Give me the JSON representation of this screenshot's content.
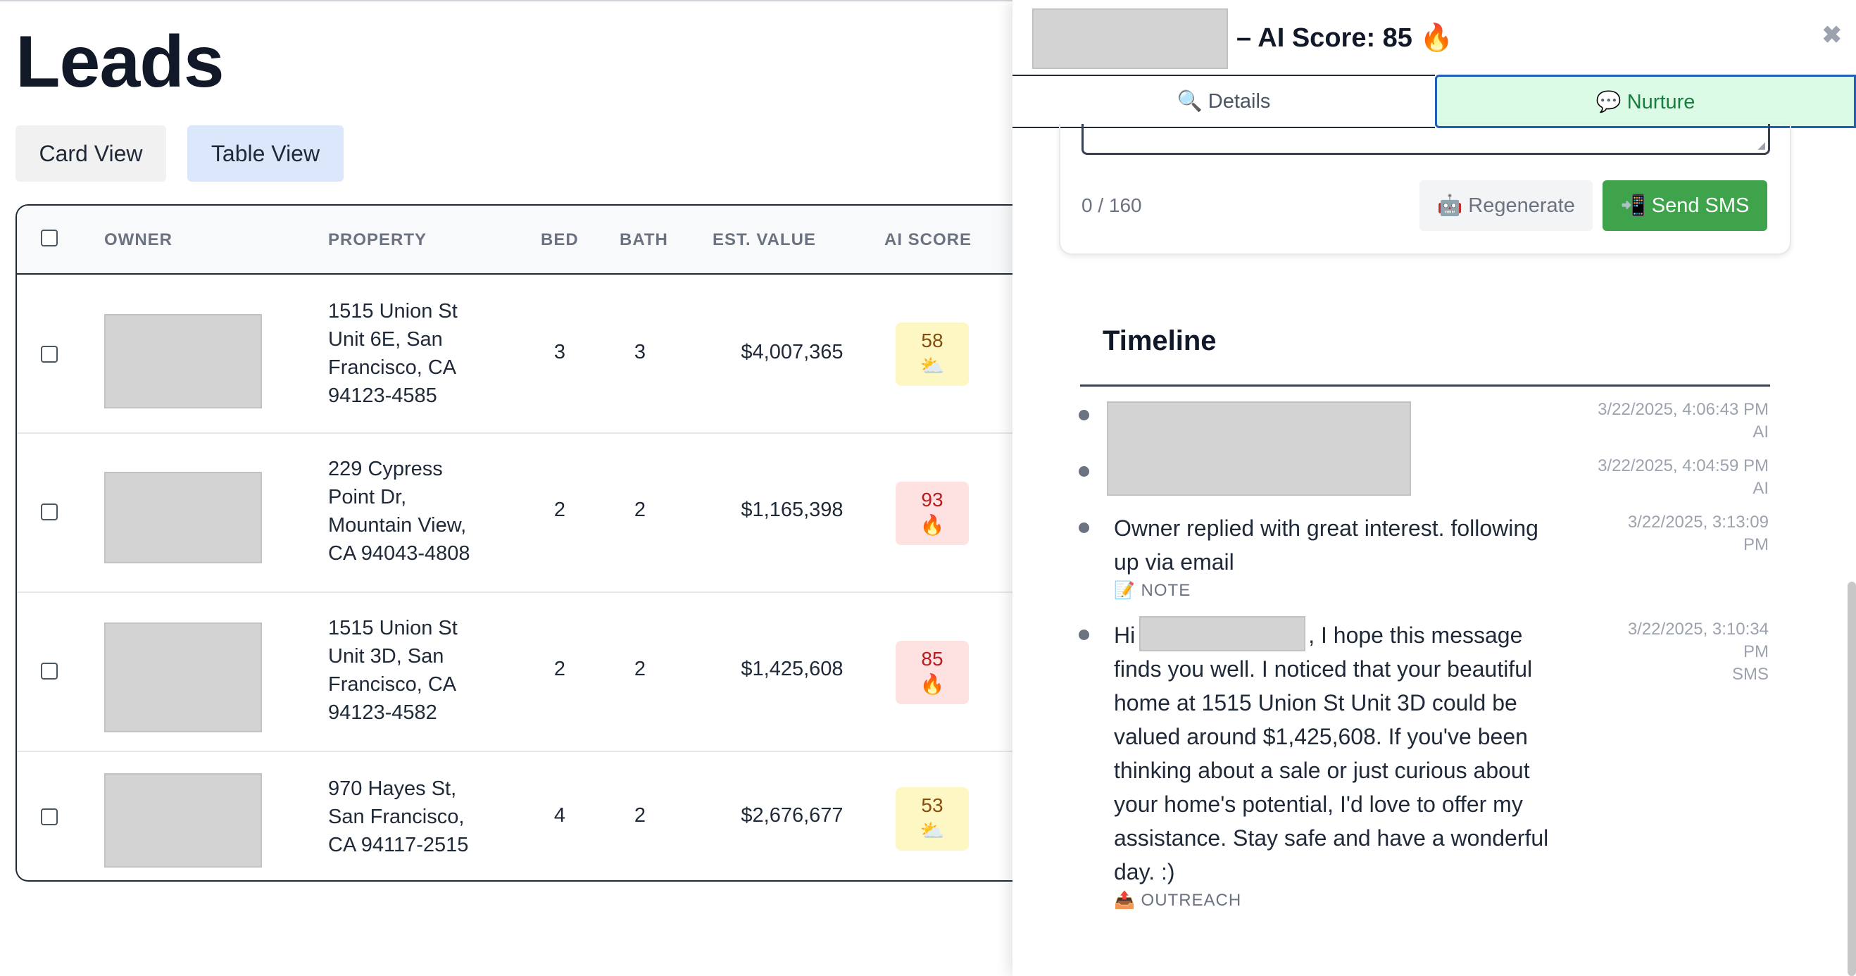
{
  "page": {
    "title": "Leads"
  },
  "view_toggle": {
    "card_label": "Card View",
    "table_label": "Table View",
    "active": "Table View"
  },
  "table": {
    "columns": [
      "OWNER",
      "PROPERTY",
      "BED",
      "BATH",
      "EST. VALUE",
      "AI SCORE"
    ],
    "rows": [
      {
        "address_lines": [
          "1515 Union St",
          "Unit 6E, San",
          "Francisco, CA",
          "94123-4585"
        ],
        "bed": "3",
        "bath": "3",
        "value": "$4,007,365",
        "score": "58",
        "score_icon": "⛅"
      },
      {
        "address_lines": [
          "229 Cypress",
          "Point Dr,",
          "Mountain View,",
          "CA 94043-4808"
        ],
        "bed": "2",
        "bath": "2",
        "value": "$1,165,398",
        "score": "93",
        "score_icon": "🔥"
      },
      {
        "address_lines": [
          "1515 Union St",
          "Unit 3D, San",
          "Francisco, CA",
          "94123-4582"
        ],
        "bed": "2",
        "bath": "2",
        "value": "$1,425,608",
        "score": "85",
        "score_icon": "🔥"
      },
      {
        "address_lines": [
          "970 Hayes St,",
          "San Francisco,",
          "CA 94117-2515"
        ],
        "bed": "4",
        "bath": "2",
        "value": "$2,676,677",
        "score": "53",
        "score_icon": "⛅"
      }
    ]
  },
  "drawer": {
    "title": "– AI Score: 85 🔥",
    "close": "✖",
    "tabs": {
      "details": "🔍 Details",
      "nurture": "💬 Nurture",
      "active": "Nurture"
    },
    "sms": {
      "counter": "0 / 160",
      "regenerate": "🤖 Regenerate",
      "send": "📲 Send SMS"
    },
    "timeline": {
      "title": "Timeline",
      "entries": [
        {
          "time_lines": [
            "3/22/2025, 4:06:43 PM",
            "AI"
          ]
        },
        {
          "time_lines": [
            "3/22/2025, 4:04:59 PM",
            "AI"
          ]
        },
        {
          "text_lines": [
            "Owner replied with great interest. following",
            "up via email"
          ],
          "tag": "📝 NOTE",
          "time_lines": [
            "3/22/2025, 3:13:09",
            "PM"
          ]
        },
        {
          "text_first": "Hi",
          "text_after_name": ", I hope this message",
          "text_lines": [
            "finds you well. I noticed that your beautiful",
            "home at 1515 Union St Unit 3D could be",
            "valued around $1,425,608. If you've been",
            "thinking about a sale or just curious about",
            "your home's potential, I'd love to offer my",
            "assistance. Stay safe and have a wonderful",
            "day. :)"
          ],
          "tag": "📤 OUTREACH",
          "time_lines": [
            "3/22/2025, 3:10:34",
            "PM",
            "SMS"
          ]
        }
      ]
    }
  }
}
